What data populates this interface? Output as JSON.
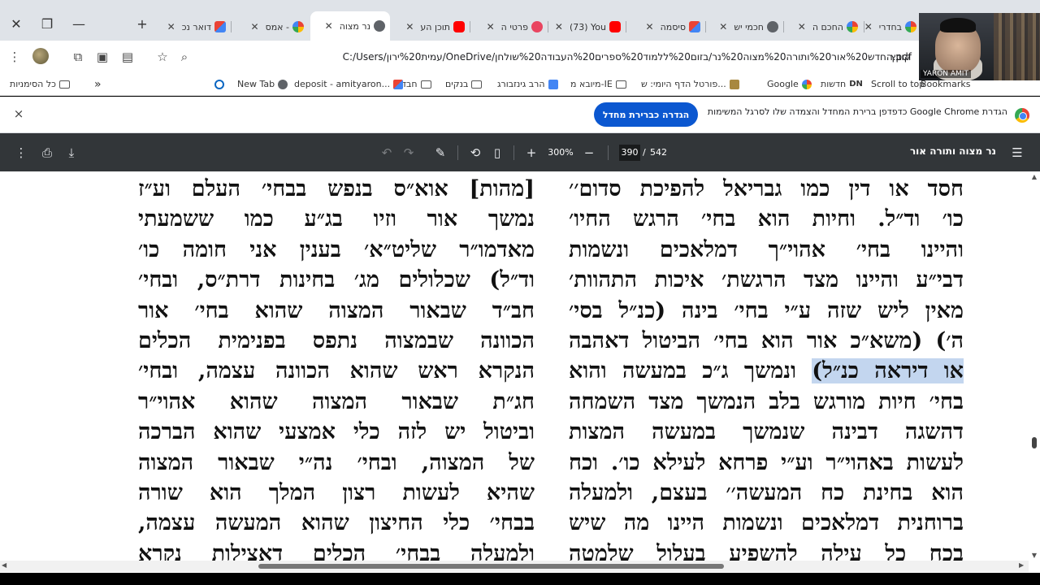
{
  "browser": {
    "tabs": [
      {
        "label": "בחדרי",
        "icon": "google-icon"
      },
      {
        "label": "החכם ה",
        "icon": "google-icon"
      },
      {
        "label": "חכמי יש",
        "icon": "globe-icon"
      },
      {
        "label": "סיסמה",
        "icon": "gmail-icon"
      },
      {
        "label": "(73) You",
        "icon": "youtube-icon"
      },
      {
        "label": "פרטי ה",
        "icon": "record-icon"
      },
      {
        "label": "תוכן הע",
        "icon": "youtube-icon"
      },
      {
        "label": "נר מצוה",
        "icon": "pdf-icon",
        "active": true
      },
      {
        "label": "אמס - ",
        "icon": "google-icon"
      },
      {
        "label": "דואר נכ",
        "icon": "gmail-icon"
      }
    ],
    "address": "C:/Users/עמית%20ירון/OneDrive/החדש%20אור%20ותורה%20מצוה%20נר/בזום%20ללמוד%20ספרים%20העבודה%20שולחן.pdf",
    "site_label": "קובץ",
    "bookmarks": [
      {
        "label": "Scroll to top",
        "icon": "scroll-icon"
      },
      {
        "label": "חדשות",
        "icon": "dn-icon"
      },
      {
        "label": "Google",
        "icon": "google-icon"
      },
      {
        "label": "פורטל הדף היומי: ש...",
        "icon": "portal-icon"
      },
      {
        "label": "מיובא מ-IE",
        "icon": "folder-icon"
      },
      {
        "label": "הרב גינזבורג",
        "icon": "folder-icon"
      },
      {
        "label": "בנקים",
        "icon": "translate-icon"
      },
      {
        "label": "חבד",
        "icon": "folder-icon"
      },
      {
        "label": "deposit - amityaron...",
        "icon": "gmail-icon"
      },
      {
        "label": "New Tab",
        "icon": "globe-icon"
      },
      {
        "label": "",
        "icon": "circle-icon"
      },
      {
        "label": "כל הסימניות",
        "icon": "folder-icon"
      }
    ],
    "bookmarks_overflow": "»",
    "bookmarks_right": "Bookmarks"
  },
  "infobar": {
    "message": "הגדרת Google Chrome כדפדפן ברירת המחדל והצמדה שלו לסרגל המשימות",
    "button": "הגדרה כברירת מחדל",
    "close": "×"
  },
  "pdf": {
    "title": "נר מצוה ותורה אור",
    "zoom": "300%",
    "page_current": "390",
    "page_separator": "/",
    "page_total": "542",
    "right_column": [
      "חסד או דין כמו גבריאל להפיכת סדום׳׳",
      "כו׳ וד״ל. וחיות הוא בחי׳ הרגש החיו׳",
      "והיינו בחי׳ אהוי״ך דמלאכים ונשמות",
      "דבי״ע והיינו מצד הרגשת׳ איכות התהוות׳",
      "מאין ליש שזה ע״י בחי׳ בינה (כנ״ל בסי׳",
      "ה׳) (משא״כ אור הוא בחי׳ הביטול דאהבה",
      "ונמשך ג״כ במעשה והוא",
      "בחי׳ חיות מורגש בלב הנמשך מצד השמחה",
      "דהשגה דבינה שנמשך במעשה המצות",
      "לעשות באהוי״ר וע״י פרחא לעילא כו׳. וכח",
      "הוא בחינת כח המעשה׳׳ בעצם, ולמעלה",
      "ברוחנית דמלאכים ונשמות היינו מה שיש",
      "בכח כל עילה להשפיע בעלול שלמטה"
    ],
    "right_highlight": "או דיראה כנ״ל)",
    "left_column": [
      "[מהות] אוא״ס בנפש בבחי׳ העלם וע״ז",
      "נמשך אור וזיו בג״ע כמו ששמעתי",
      "מאדמו״ר שליט״א׳ בענין אני חומה כו׳",
      "וד״ל) שכלולים מג׳ בחינות דרת״ס, ובחי׳",
      "חב״ד שבאור המצוה שהוא בחי׳ אור",
      "הכוונה שבמצוה נתפס בפנימית הכלים",
      "הנקרא ראש שהוא הכוונה עצמה, ובחי׳",
      "חג״ת שבאור המצוה שהוא אהוי״ר",
      "וביטול יש לזה כלי אמצעי שהוא הברכה",
      "של המצוה, ובחי׳ נה״י שבאור המצוה",
      "שהיא לעשות רצון המלך הוא שורה",
      "בבחי׳ כלי החיצון שהוא המעשה עצמה,",
      "ולמעלה בבחי׳ הכלים דאצילות נקרא"
    ]
  },
  "webcam": {
    "name": "YARON AMIT"
  }
}
